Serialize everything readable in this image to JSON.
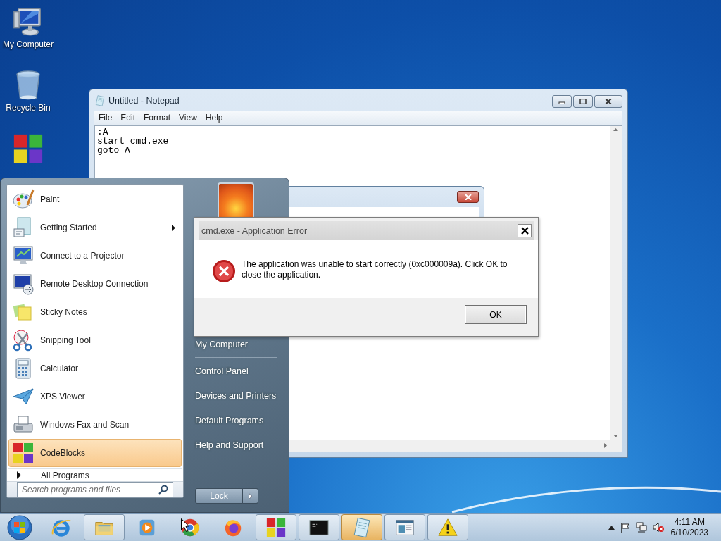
{
  "desktop_icons": [
    {
      "label": "My Computer",
      "kind": "computer"
    },
    {
      "label": "Recycle Bin",
      "kind": "bin"
    },
    {
      "kind": "codeblocks"
    }
  ],
  "notepad": {
    "title": "Untitled - Notepad",
    "menu": [
      "File",
      "Edit",
      "Format",
      "View",
      "Help"
    ],
    "lines": [
      ":A",
      "start cmd.exe",
      "goto A"
    ]
  },
  "start_menu": {
    "programs": [
      {
        "label": "Paint",
        "kind": "paint",
        "submenu": false,
        "selected": false
      },
      {
        "label": "Getting Started",
        "kind": "document",
        "submenu": true,
        "selected": false
      },
      {
        "label": "Connect to a Projector",
        "kind": "projector",
        "submenu": false,
        "selected": false
      },
      {
        "label": "Remote Desktop Connection",
        "kind": "remote",
        "submenu": false,
        "selected": false
      },
      {
        "label": "Sticky Notes",
        "kind": "sticky",
        "submenu": false,
        "selected": false
      },
      {
        "label": "Snipping Tool",
        "kind": "scissors",
        "submenu": false,
        "selected": false
      },
      {
        "label": "Calculator",
        "kind": "calculator",
        "submenu": false,
        "selected": false
      },
      {
        "label": "XPS Viewer",
        "kind": "plane",
        "submenu": false,
        "selected": false
      },
      {
        "label": "Windows Fax and Scan",
        "kind": "fax",
        "submenu": false,
        "selected": false
      },
      {
        "label": "CodeBlocks",
        "kind": "codeblocks",
        "submenu": false,
        "selected": true
      }
    ],
    "all_programs": "All Programs",
    "search": {
      "placeholder": "Search programs and files"
    },
    "places": [
      "My Computer",
      "Control Panel",
      "Devices and Printers",
      "Default Programs",
      "Help and Support"
    ],
    "shutdown": "Lock"
  },
  "error_dialog": {
    "title": "cmd.exe - Application Error",
    "message": "The application was unable to start correctly (0xc000009a). Click OK to close the application.",
    "button": "OK"
  },
  "taskbar": {
    "items": [
      {
        "kind": "ie",
        "running": false,
        "selected": false
      },
      {
        "kind": "folder",
        "running": true,
        "selected": false
      },
      {
        "kind": "media",
        "running": false,
        "selected": false
      },
      {
        "kind": "chrome",
        "running": false,
        "selected": false
      },
      {
        "kind": "firefox",
        "running": false,
        "selected": false
      },
      {
        "kind": "codeblocks",
        "running": true,
        "selected": false
      },
      {
        "kind": "cmd",
        "running": true,
        "selected": false
      },
      {
        "kind": "notepad",
        "running": true,
        "selected": true
      },
      {
        "kind": "window",
        "running": true,
        "selected": false
      },
      {
        "kind": "warning",
        "running": true,
        "selected": false
      }
    ],
    "clock": {
      "time": "4:11 AM",
      "date": "6/10/2023"
    }
  }
}
